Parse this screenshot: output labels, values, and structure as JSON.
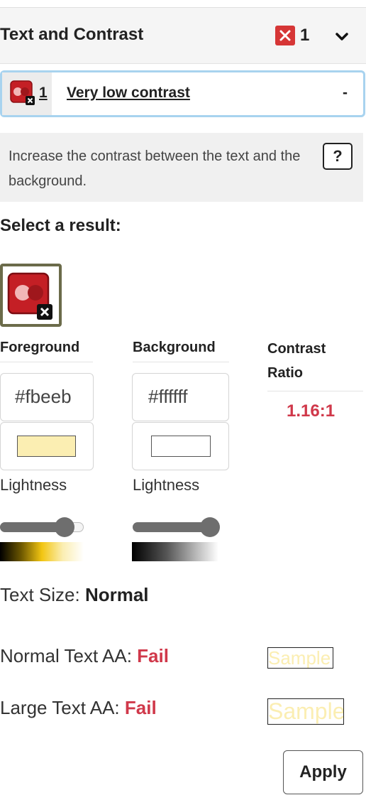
{
  "header": {
    "title": "Text and Contrast",
    "error_icon": "x-icon",
    "error_count": "1",
    "expand_icon": "chevron-down-icon"
  },
  "issue": {
    "icon": "contrast-error-icon",
    "number": "1",
    "label": "Very low contrast",
    "trailing": "-"
  },
  "help": {
    "text": "Increase the contrast between the text and the background.",
    "button_label": "?"
  },
  "results": {
    "label": "Select a result:"
  },
  "foreground": {
    "header": "Foreground",
    "hex": "#fbeeb",
    "swatch_color": "#fbeeb2",
    "lightness_label": "Lightness",
    "lightness": 0.78
  },
  "background": {
    "header": "Background",
    "hex": "#ffffff",
    "swatch_color": "#ffffff",
    "lightness_label": "Lightness",
    "lightness": 1.0
  },
  "contrast": {
    "header": "Contrast Ratio",
    "value": "1.16:1"
  },
  "text_size": {
    "label": "Text Size:",
    "value": "Normal"
  },
  "checks": {
    "normal_label": "Normal Text AA:",
    "normal_result": "Fail",
    "large_label": "Large Text AA:",
    "large_result": "Fail",
    "sample_text": "Sample"
  },
  "actions": {
    "apply_label": "Apply"
  },
  "colors": {
    "error_red": "#d63636",
    "fail_red": "#d0384a",
    "focus_blue": "#a8d3ef"
  }
}
